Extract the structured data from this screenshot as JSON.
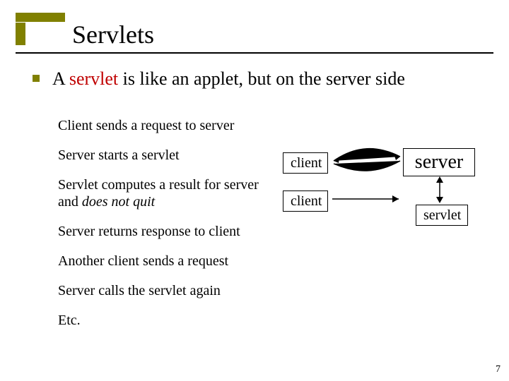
{
  "title": "Servlets",
  "lead": {
    "pre": "A ",
    "highlight": "servlet",
    "post": " is like an applet, but on the server side"
  },
  "steps": {
    "s1": "Client sends a request to server",
    "s2": "Server starts a servlet",
    "s3a": "Servlet computes a result for server and ",
    "s3b": "does not quit",
    "s4": "Server returns response to client",
    "s5": "Another client sends a request",
    "s6": "Server calls the servlet again",
    "s7": "Etc."
  },
  "diagram": {
    "client1": "client",
    "client2": "client",
    "server": "server",
    "servlet": "servlet"
  },
  "page_number": "7"
}
